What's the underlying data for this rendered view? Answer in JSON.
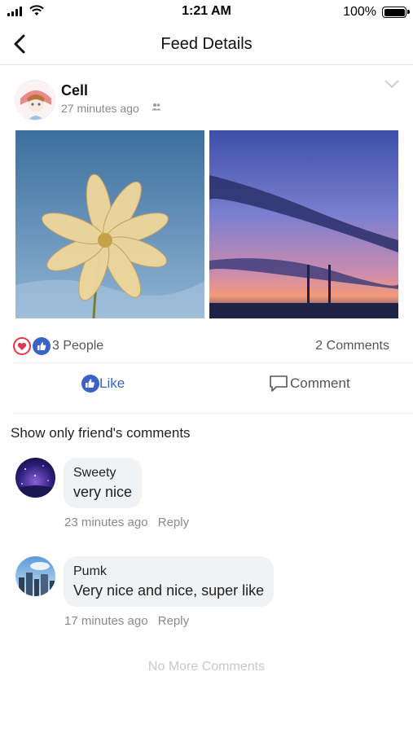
{
  "status_bar": {
    "time": "1:21 AM",
    "battery": "100%"
  },
  "nav": {
    "title": "Feed Details",
    "back_icon": "chevron-left-icon"
  },
  "post": {
    "author": "Cell",
    "time": "27 minutes ago",
    "audience_icon": "friends-icon",
    "menu_icon": "chevron-down-icon",
    "images": [
      "flower-photo",
      "sunset-photo"
    ],
    "reactions_count": "3 People",
    "comments_count": "2 Comments"
  },
  "actions": {
    "like": "Like",
    "comment": "Comment"
  },
  "filter_label": "Show only friend's comments",
  "comments": [
    {
      "name": "Sweety",
      "text": "very nice",
      "time": "23 minutes ago",
      "reply": "Reply"
    },
    {
      "name": "Pumk",
      "text": "Very nice and nice, super like",
      "time": "17 minutes ago",
      "reply": "Reply"
    }
  ],
  "footer": "No More Comments",
  "colors": {
    "like_blue": "#3b63c4",
    "heart_red": "#e0384b",
    "meta_gray": "#8a8a8a"
  }
}
